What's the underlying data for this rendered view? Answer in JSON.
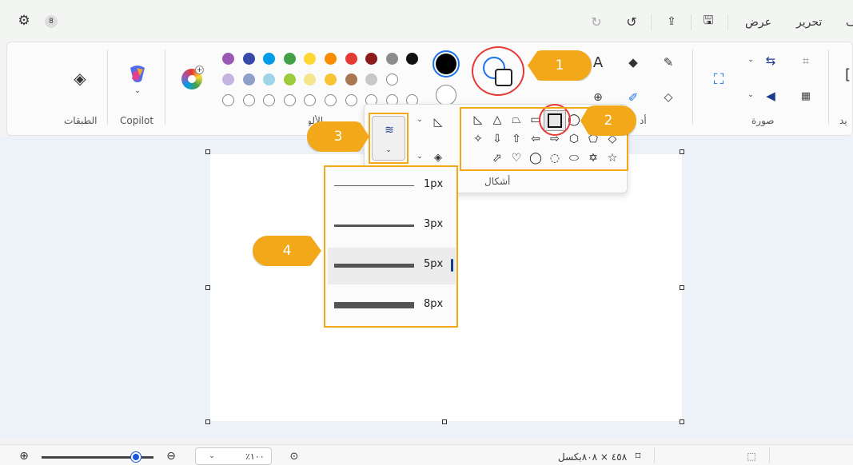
{
  "titlebar": {
    "menu_edit": "تحرير",
    "menu_view": "عرض",
    "menu_file_partial": "ف"
  },
  "ribbon": {
    "layers_label": "الطبقات",
    "copilot_label": "Copilot",
    "colors_label_partial": "الألوان",
    "tools_label_partial": "أد",
    "image_label": "صورة",
    "select_label_partial": "يد",
    "shapes_label": "أشكال",
    "colors_row1": [
      "#9b59b6",
      "#3949ab",
      "#039be5",
      "#43a047",
      "#fdd835",
      "#fb8c00",
      "#e53935",
      "#8e1b1b",
      "#8c8c8c",
      "#111111"
    ],
    "colors_row2": [
      "#c5b3e0",
      "#8fa0c8",
      "#9fd3e8",
      "#9ccc3c",
      "#f5e58c",
      "#f7c332",
      "#a97852",
      "#c8c8c8",
      "#ffffff"
    ]
  },
  "brush_sizes": [
    {
      "label": "1px",
      "thickness": 1
    },
    {
      "label": "3px",
      "thickness": 3
    },
    {
      "label": "5px",
      "thickness": 5
    },
    {
      "label": "8px",
      "thickness": 8
    }
  ],
  "callouts": [
    "1",
    "2",
    "3",
    "4"
  ],
  "status": {
    "zoom_value": "٪١٠٠",
    "canvas_size": "٤٥٨ × ٨٠٨بكسل"
  }
}
